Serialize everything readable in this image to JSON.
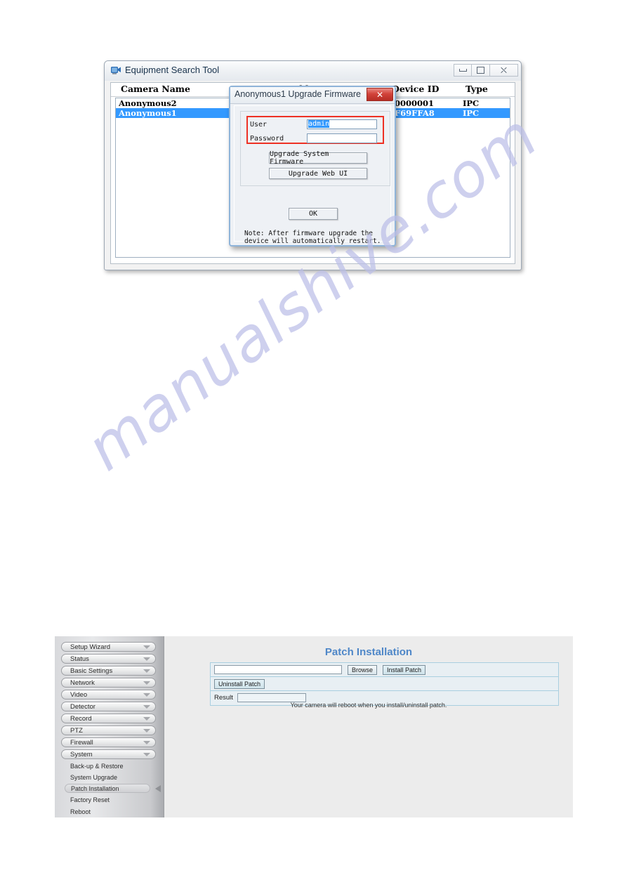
{
  "watermark": {
    "text": "manualshive.com",
    "color": "#bcbfe8"
  },
  "equipment_search_tool": {
    "title": "Equipment Search Tool",
    "app_icon": "camera-monitor-icon",
    "window_controls": {
      "minimize": "minimize-icon",
      "maximize": "maximize-icon",
      "close": "close-icon"
    },
    "columns": [
      "Camera Name",
      "IP Address",
      "Device ID",
      "Type"
    ],
    "rows": [
      {
        "camera_name": "Anonymous2",
        "ip_address": "",
        "device_id": "00000001",
        "type": "IPC",
        "selected": false
      },
      {
        "camera_name": "Anonymous1",
        "ip_address": "",
        "device_id": "5F69FFA8",
        "type": "IPC",
        "selected": true
      }
    ]
  },
  "upgrade_dialog": {
    "title": "Anonymous1 Upgrade Firmware",
    "close_label": "✕",
    "fields": {
      "user_label": "User",
      "user_value": "admin",
      "password_label": "Password",
      "password_value": ""
    },
    "buttons": {
      "upgrade_system_firmware": "Upgrade System Firmware",
      "upgrade_web_ui": "Upgrade Web UI",
      "ok": "OK"
    },
    "note": "Note: After firmware upgrade the device will automatically restart.",
    "highlight_color": "#ee3124"
  },
  "web_ui": {
    "sidebar": {
      "groups": [
        {
          "label": "Setup Wizard"
        },
        {
          "label": "Status"
        },
        {
          "label": "Basic Settings"
        },
        {
          "label": "Network"
        },
        {
          "label": "Video"
        },
        {
          "label": "Detector"
        },
        {
          "label": "Record"
        },
        {
          "label": "PTZ"
        },
        {
          "label": "Firewall"
        },
        {
          "label": "System"
        }
      ],
      "system_items": [
        {
          "label": "Back-up & Restore",
          "active": false
        },
        {
          "label": "System Upgrade",
          "active": false
        },
        {
          "label": "Patch Installation",
          "active": true
        },
        {
          "label": "Factory Reset",
          "active": false
        },
        {
          "label": "Reboot",
          "active": false
        }
      ]
    },
    "main": {
      "title": "Patch Installation",
      "title_color": "#4f87c8",
      "file_value": "",
      "browse_label": "Browse",
      "install_label": "Install Patch",
      "uninstall_label": "Uninstall Patch",
      "result_label": "Result",
      "result_value": "",
      "note": "Your camera will reboot when you install/uninstall patch."
    }
  }
}
